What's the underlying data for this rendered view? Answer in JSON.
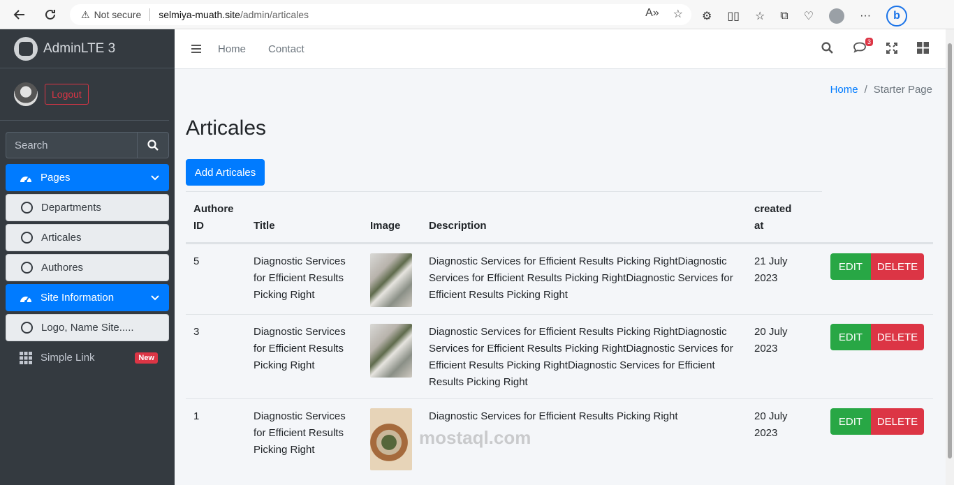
{
  "browser": {
    "security_label": "Not secure",
    "url_host": "selmiya-muath.site",
    "url_path": "/admin/articales"
  },
  "sidebar": {
    "brand": "AdminLTE 3",
    "logout_label": "Logout",
    "search_placeholder": "Search",
    "items": [
      {
        "label": "Pages",
        "type": "active"
      },
      {
        "label": "Departments",
        "type": "sub"
      },
      {
        "label": "Articales",
        "type": "sub"
      },
      {
        "label": "Authores",
        "type": "sub"
      },
      {
        "label": "Site Information",
        "type": "active"
      },
      {
        "label": "Logo, Name Site.....",
        "type": "sub"
      },
      {
        "label": "Simple Link",
        "type": "plain",
        "badge": "New"
      }
    ]
  },
  "topbar": {
    "links": [
      "Home",
      "Contact"
    ],
    "messages_count": "3"
  },
  "breadcrumb": {
    "home": "Home",
    "current": "Starter Page"
  },
  "page": {
    "title": "Articales",
    "add_button": "Add Articales"
  },
  "table": {
    "headers": {
      "author_id_line1": "Authore",
      "author_id_line2": "ID",
      "title": "Title",
      "image": "Image",
      "description": "Description",
      "created_line1": "created",
      "created_line2": "at"
    },
    "rows": [
      {
        "author_id": "5",
        "title": "Diagnostic Services for Efficient Results Picking Right",
        "description": "Diagnostic Services for Efficient Results Picking RightDiagnostic Services for Efficient Results Picking RightDiagnostic Services for Efficient Results Picking Right",
        "created_line1": "21 July",
        "created_line2": "2023",
        "edit": "EDIT",
        "delete": "DELETE"
      },
      {
        "author_id": "3",
        "title": "Diagnostic Services for Efficient Results Picking Right",
        "description": "Diagnostic Services for Efficient Results Picking RightDiagnostic Services for Efficient Results Picking RightDiagnostic Services for Efficient Results Picking RightDiagnostic Services for Efficient Results Picking Right",
        "created_line1": "20 July",
        "created_line2": "2023",
        "edit": "EDIT",
        "delete": "DELETE"
      },
      {
        "author_id": "1",
        "title": "Diagnostic Services for Efficient Results Picking Right",
        "description": "Diagnostic Services for Efficient Results Picking Right",
        "created_line1": "20 July",
        "created_line2": "2023",
        "edit": "EDIT",
        "delete": "DELETE"
      }
    ]
  },
  "watermark": "mostaql.com"
}
